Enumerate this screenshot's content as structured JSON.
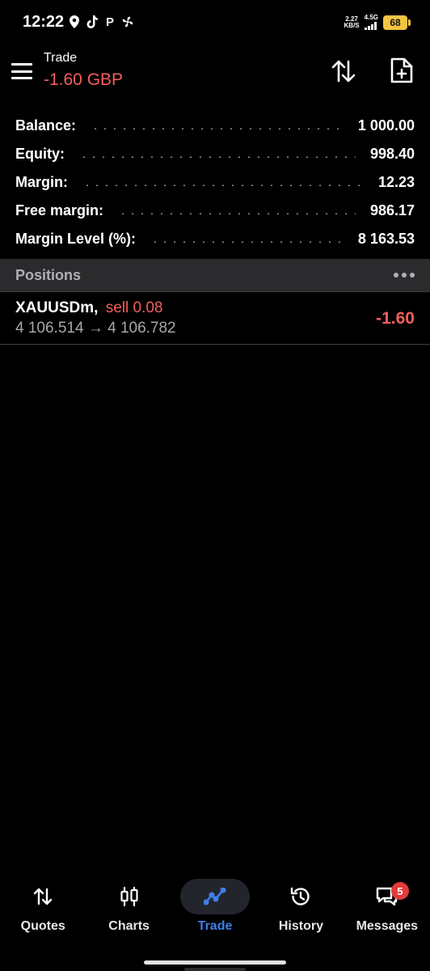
{
  "status_bar": {
    "time": "12:22",
    "left_icons": [
      "location-pin-icon",
      "tiktok-icon",
      "p-app-icon",
      "fan-icon"
    ],
    "p_glyph": "P",
    "net_speed_value": "2.27",
    "net_speed_unit": "KB/S",
    "network_type": "4.5G",
    "battery": "68"
  },
  "header": {
    "title": "Trade",
    "profit_loss": "-1.60 GBP",
    "icons": [
      "sort-arrows-icon",
      "new-order-document-icon"
    ]
  },
  "summary": [
    {
      "label": "Balance:",
      "value": "1 000.00"
    },
    {
      "label": "Equity:",
      "value": "998.40"
    },
    {
      "label": "Margin:",
      "value": "12.23"
    },
    {
      "label": "Free margin:",
      "value": "986.17"
    },
    {
      "label": "Margin Level (%):",
      "value": "8 163.53"
    }
  ],
  "positions": {
    "title": "Positions",
    "items": [
      {
        "symbol": "XAUUSDm",
        "separator": ",",
        "type": "sell 0.08",
        "open_price": "4 106.514",
        "arrow": "→",
        "current_price": "4 106.782",
        "profit": "-1.60"
      }
    ]
  },
  "bottom_nav": {
    "active": "Trade",
    "items": [
      {
        "label": "Quotes",
        "icon": "quotes-arrows-icon"
      },
      {
        "label": "Charts",
        "icon": "candlestick-chart-icon"
      },
      {
        "label": "Trade",
        "icon": "trade-line-icon"
      },
      {
        "label": "History",
        "icon": "history-clock-icon"
      },
      {
        "label": "Messages",
        "icon": "messages-chat-icon",
        "badge": "5"
      }
    ]
  },
  "colors": {
    "background": "#000000",
    "loss": "#f25f5c",
    "accent": "#3e7fe6",
    "section_header": "#2b2b2d",
    "badge": "#e23b3b",
    "battery": "#f5c542"
  }
}
